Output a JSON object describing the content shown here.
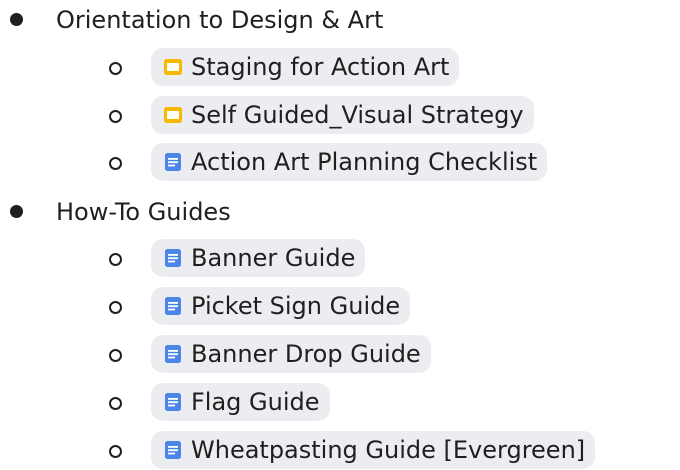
{
  "colors": {
    "chip_background": "#ecedf0",
    "doc_icon": "#4a86e8",
    "slides_icon": "#f6b800",
    "text": "#1f1f1f"
  },
  "outline": [
    {
      "label": "Orientation to Design & Art",
      "items": [
        {
          "label": "Staging for Action Art",
          "icon": "slides-icon"
        },
        {
          "label": "Self Guided_Visual Strategy",
          "icon": "slides-icon"
        },
        {
          "label": "Action Art Planning Checklist",
          "icon": "doc-icon"
        }
      ]
    },
    {
      "label": "How-To Guides",
      "items": [
        {
          "label": "Banner Guide",
          "icon": "doc-icon"
        },
        {
          "label": "Picket Sign Guide",
          "icon": "doc-icon"
        },
        {
          "label": "Banner Drop Guide",
          "icon": "doc-icon"
        },
        {
          "label": "Flag Guide",
          "icon": "doc-icon"
        },
        {
          "label": "Wheatpasting Guide [Evergreen]",
          "icon": "doc-icon"
        }
      ]
    }
  ]
}
